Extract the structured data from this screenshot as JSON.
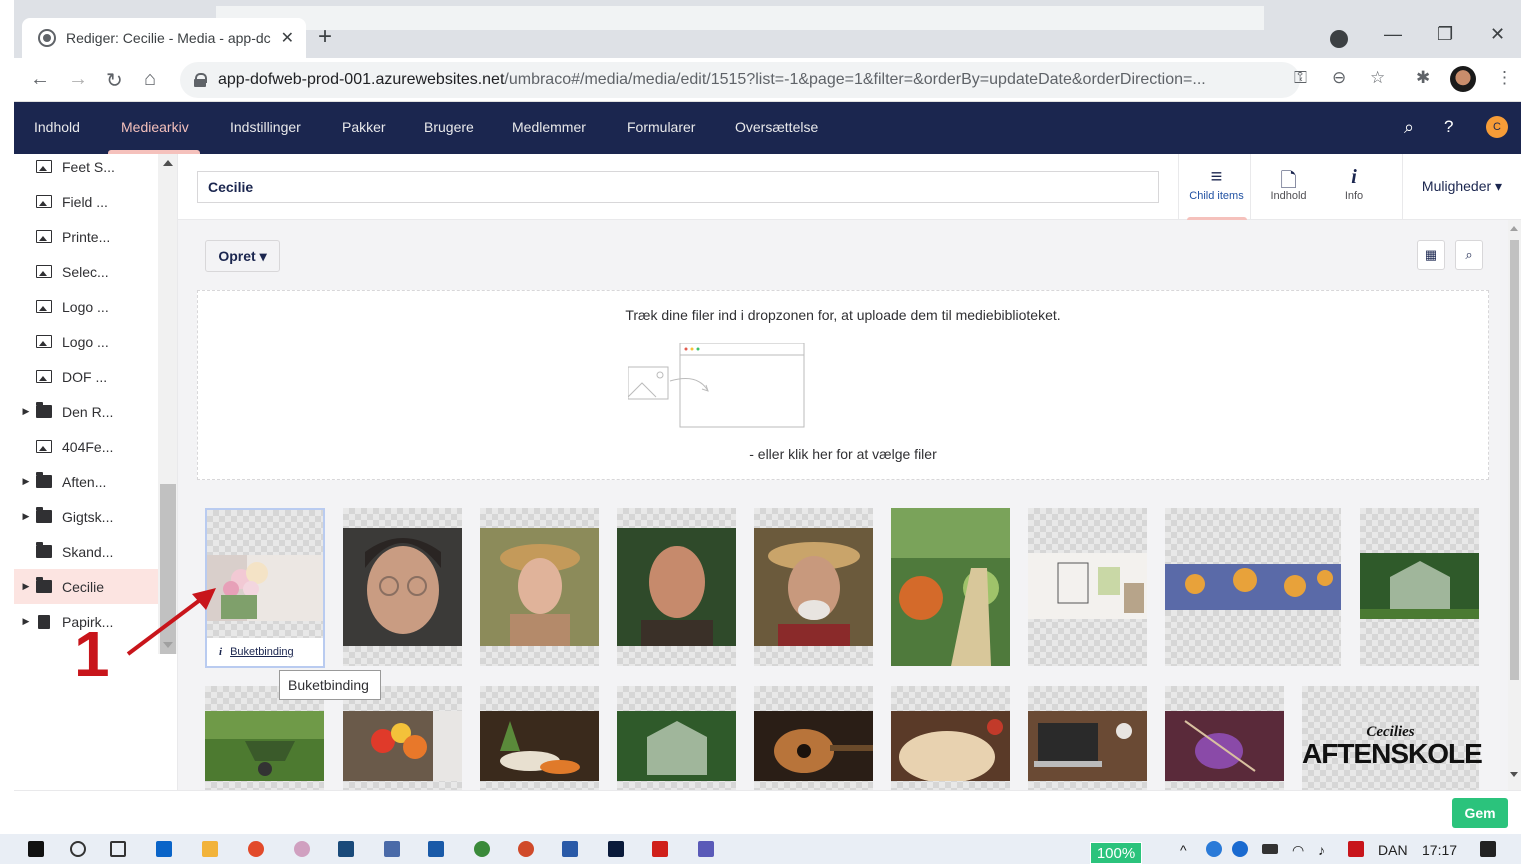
{
  "browser": {
    "tab_title": "Rediger: Cecilie - Media - app-dc",
    "url_host": "app-dofweb-prod-001.azurewebsites.net",
    "url_rest": "/umbraco#/media/media/edit/1515?list=-1&page=1&filter=&orderBy=updateDate&orderDirection=..."
  },
  "topnav": {
    "items": [
      "Indhold",
      "Mediearkiv",
      "Indstillinger",
      "Pakker",
      "Brugere",
      "Medlemmer",
      "Formularer",
      "Oversættelse"
    ],
    "active": "Mediearkiv",
    "user_initial": "C"
  },
  "tree": {
    "items": [
      {
        "label": "Feet S...",
        "type": "image"
      },
      {
        "label": "Field ...",
        "type": "image"
      },
      {
        "label": "Printe...",
        "type": "image"
      },
      {
        "label": "Selec...",
        "type": "image"
      },
      {
        "label": "Logo ...",
        "type": "image"
      },
      {
        "label": "Logo ...",
        "type": "image"
      },
      {
        "label": "DOF ...",
        "type": "image"
      },
      {
        "label": "Den R...",
        "type": "folder"
      },
      {
        "label": "404Fe...",
        "type": "image"
      },
      {
        "label": "Aften...",
        "type": "folder"
      },
      {
        "label": "Gigtsk...",
        "type": "folder"
      },
      {
        "label": "Skand...",
        "type": "folder"
      },
      {
        "label": "Cecilie",
        "type": "folder"
      },
      {
        "label": "Papirk...",
        "type": "trash"
      }
    ]
  },
  "editor": {
    "name": "Cecilie",
    "apps": [
      "Child items",
      "Indhold",
      "Info"
    ],
    "options_label": "Muligheder",
    "create_label": "Opret",
    "dropzone_text": "Træk dine filer ind i dropzonen for, at uploade dem til mediebiblioteket.",
    "dropzone_link": "- eller klik her for at vælge filer",
    "selected_item": "Buketbinding",
    "tooltip": "Buketbinding",
    "annotation_number": "1",
    "save_label": "Gem",
    "brand_text_line1": "Cecilies",
    "brand_text_line2": "AFTENSKOLE"
  },
  "taskbar": {
    "zoom": "100%",
    "lang": "DAN",
    "time": "17:17"
  },
  "colors": {
    "nav_bg": "#1b264f",
    "accent": "#f5c1bc",
    "save_green": "#2bc37c"
  }
}
